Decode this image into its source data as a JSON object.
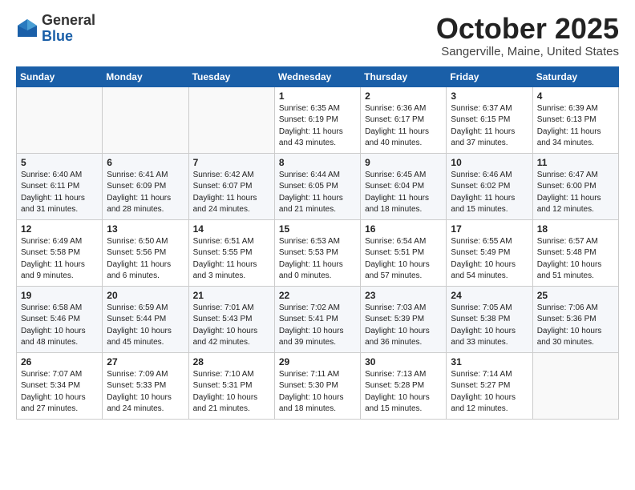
{
  "logo": {
    "general": "General",
    "blue": "Blue"
  },
  "title": "October 2025",
  "subtitle": "Sangerville, Maine, United States",
  "days_header": [
    "Sunday",
    "Monday",
    "Tuesday",
    "Wednesday",
    "Thursday",
    "Friday",
    "Saturday"
  ],
  "weeks": [
    [
      {
        "day": "",
        "info": ""
      },
      {
        "day": "",
        "info": ""
      },
      {
        "day": "",
        "info": ""
      },
      {
        "day": "1",
        "info": "Sunrise: 6:35 AM\nSunset: 6:19 PM\nDaylight: 11 hours\nand 43 minutes."
      },
      {
        "day": "2",
        "info": "Sunrise: 6:36 AM\nSunset: 6:17 PM\nDaylight: 11 hours\nand 40 minutes."
      },
      {
        "day": "3",
        "info": "Sunrise: 6:37 AM\nSunset: 6:15 PM\nDaylight: 11 hours\nand 37 minutes."
      },
      {
        "day": "4",
        "info": "Sunrise: 6:39 AM\nSunset: 6:13 PM\nDaylight: 11 hours\nand 34 minutes."
      }
    ],
    [
      {
        "day": "5",
        "info": "Sunrise: 6:40 AM\nSunset: 6:11 PM\nDaylight: 11 hours\nand 31 minutes."
      },
      {
        "day": "6",
        "info": "Sunrise: 6:41 AM\nSunset: 6:09 PM\nDaylight: 11 hours\nand 28 minutes."
      },
      {
        "day": "7",
        "info": "Sunrise: 6:42 AM\nSunset: 6:07 PM\nDaylight: 11 hours\nand 24 minutes."
      },
      {
        "day": "8",
        "info": "Sunrise: 6:44 AM\nSunset: 6:05 PM\nDaylight: 11 hours\nand 21 minutes."
      },
      {
        "day": "9",
        "info": "Sunrise: 6:45 AM\nSunset: 6:04 PM\nDaylight: 11 hours\nand 18 minutes."
      },
      {
        "day": "10",
        "info": "Sunrise: 6:46 AM\nSunset: 6:02 PM\nDaylight: 11 hours\nand 15 minutes."
      },
      {
        "day": "11",
        "info": "Sunrise: 6:47 AM\nSunset: 6:00 PM\nDaylight: 11 hours\nand 12 minutes."
      }
    ],
    [
      {
        "day": "12",
        "info": "Sunrise: 6:49 AM\nSunset: 5:58 PM\nDaylight: 11 hours\nand 9 minutes."
      },
      {
        "day": "13",
        "info": "Sunrise: 6:50 AM\nSunset: 5:56 PM\nDaylight: 11 hours\nand 6 minutes."
      },
      {
        "day": "14",
        "info": "Sunrise: 6:51 AM\nSunset: 5:55 PM\nDaylight: 11 hours\nand 3 minutes."
      },
      {
        "day": "15",
        "info": "Sunrise: 6:53 AM\nSunset: 5:53 PM\nDaylight: 11 hours\nand 0 minutes."
      },
      {
        "day": "16",
        "info": "Sunrise: 6:54 AM\nSunset: 5:51 PM\nDaylight: 10 hours\nand 57 minutes."
      },
      {
        "day": "17",
        "info": "Sunrise: 6:55 AM\nSunset: 5:49 PM\nDaylight: 10 hours\nand 54 minutes."
      },
      {
        "day": "18",
        "info": "Sunrise: 6:57 AM\nSunset: 5:48 PM\nDaylight: 10 hours\nand 51 minutes."
      }
    ],
    [
      {
        "day": "19",
        "info": "Sunrise: 6:58 AM\nSunset: 5:46 PM\nDaylight: 10 hours\nand 48 minutes."
      },
      {
        "day": "20",
        "info": "Sunrise: 6:59 AM\nSunset: 5:44 PM\nDaylight: 10 hours\nand 45 minutes."
      },
      {
        "day": "21",
        "info": "Sunrise: 7:01 AM\nSunset: 5:43 PM\nDaylight: 10 hours\nand 42 minutes."
      },
      {
        "day": "22",
        "info": "Sunrise: 7:02 AM\nSunset: 5:41 PM\nDaylight: 10 hours\nand 39 minutes."
      },
      {
        "day": "23",
        "info": "Sunrise: 7:03 AM\nSunset: 5:39 PM\nDaylight: 10 hours\nand 36 minutes."
      },
      {
        "day": "24",
        "info": "Sunrise: 7:05 AM\nSunset: 5:38 PM\nDaylight: 10 hours\nand 33 minutes."
      },
      {
        "day": "25",
        "info": "Sunrise: 7:06 AM\nSunset: 5:36 PM\nDaylight: 10 hours\nand 30 minutes."
      }
    ],
    [
      {
        "day": "26",
        "info": "Sunrise: 7:07 AM\nSunset: 5:34 PM\nDaylight: 10 hours\nand 27 minutes."
      },
      {
        "day": "27",
        "info": "Sunrise: 7:09 AM\nSunset: 5:33 PM\nDaylight: 10 hours\nand 24 minutes."
      },
      {
        "day": "28",
        "info": "Sunrise: 7:10 AM\nSunset: 5:31 PM\nDaylight: 10 hours\nand 21 minutes."
      },
      {
        "day": "29",
        "info": "Sunrise: 7:11 AM\nSunset: 5:30 PM\nDaylight: 10 hours\nand 18 minutes."
      },
      {
        "day": "30",
        "info": "Sunrise: 7:13 AM\nSunset: 5:28 PM\nDaylight: 10 hours\nand 15 minutes."
      },
      {
        "day": "31",
        "info": "Sunrise: 7:14 AM\nSunset: 5:27 PM\nDaylight: 10 hours\nand 12 minutes."
      },
      {
        "day": "",
        "info": ""
      }
    ]
  ]
}
